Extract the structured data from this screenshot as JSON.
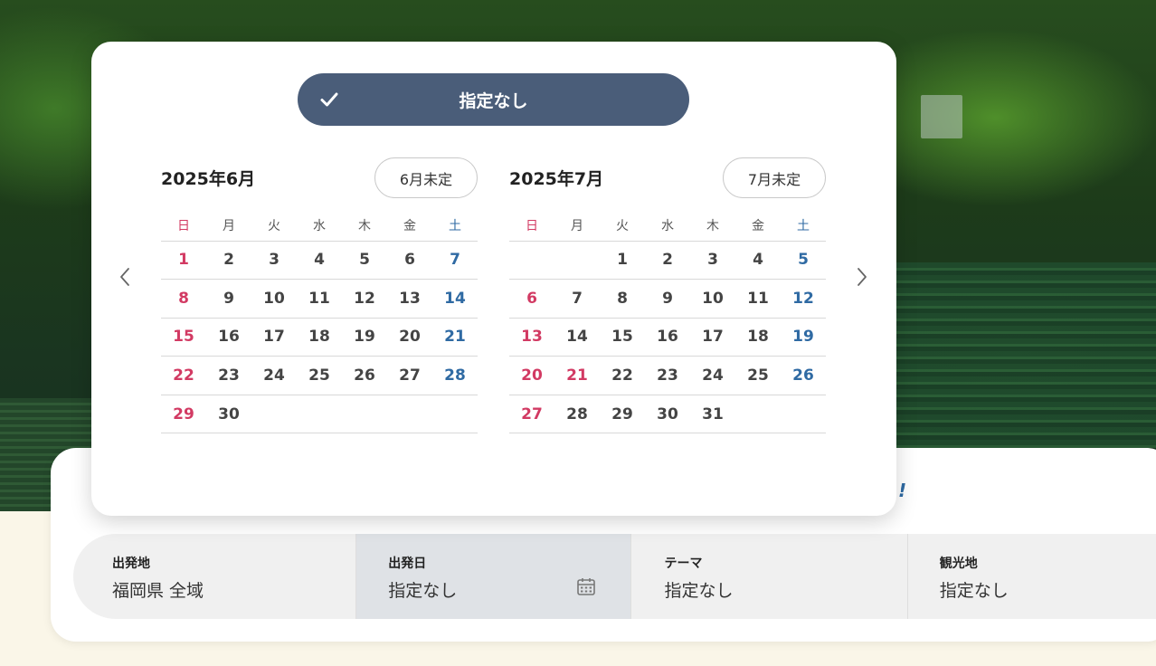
{
  "colors": {
    "toggle_bg": "#4a5d79",
    "sunday_holiday": "#d23a63",
    "saturday": "#2f6aa3",
    "selected_field_bg": "#dfe2e6"
  },
  "calendar_popup": {
    "none_toggle": {
      "label": "指定なし",
      "icon": "check-icon",
      "checked": true
    },
    "prev_icon": "chevron-left-icon",
    "next_icon": "chevron-right-icon",
    "weekdays": [
      "日",
      "月",
      "火",
      "水",
      "木",
      "金",
      "土"
    ],
    "months": [
      {
        "title": "2025年6月",
        "undecided_label": "6月未定",
        "weeks": [
          [
            "1",
            "2",
            "3",
            "4",
            "5",
            "6",
            "7"
          ],
          [
            "8",
            "9",
            "10",
            "11",
            "12",
            "13",
            "14"
          ],
          [
            "15",
            "16",
            "17",
            "18",
            "19",
            "20",
            "21"
          ],
          [
            "22",
            "23",
            "24",
            "25",
            "26",
            "27",
            "28"
          ],
          [
            "29",
            "30",
            "",
            "",
            "",
            "",
            ""
          ]
        ],
        "holidays": []
      },
      {
        "title": "2025年7月",
        "undecided_label": "7月未定",
        "weeks": [
          [
            "",
            "",
            "1",
            "2",
            "3",
            "4",
            "5"
          ],
          [
            "6",
            "7",
            "8",
            "9",
            "10",
            "11",
            "12"
          ],
          [
            "13",
            "14",
            "15",
            "16",
            "17",
            "18",
            "19"
          ],
          [
            "20",
            "21",
            "22",
            "23",
            "24",
            "25",
            "26"
          ],
          [
            "27",
            "28",
            "29",
            "30",
            "31",
            "",
            ""
          ]
        ],
        "holidays": [
          "21"
        ]
      }
    ]
  },
  "search_bar": {
    "headline_tail": "!",
    "fields": [
      {
        "label": "出発地",
        "value": "福岡県 全域"
      },
      {
        "label": "出発日",
        "value": "指定なし",
        "icon": "calendar-icon"
      },
      {
        "label": "テーマ",
        "value": "指定なし"
      },
      {
        "label": "観光地",
        "value": "指定なし"
      }
    ]
  }
}
